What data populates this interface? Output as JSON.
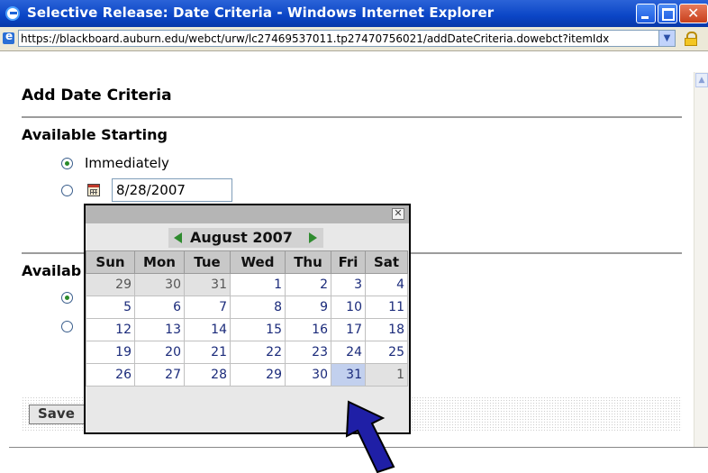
{
  "window": {
    "title": "Selective Release: Date Criteria - Windows Internet Explorer"
  },
  "address_bar": {
    "url": "https://blackboard.auburn.edu/webct/urw/lc27469537011.tp27470756021/addDateCriteria.dowebct?itemIdx",
    "icons": [
      "ie-page-icon",
      "dropdown-arrow-icon",
      "lock-icon"
    ]
  },
  "page": {
    "heading": "Add Date Criteria",
    "section_start": {
      "title": "Available Starting",
      "option_immediately": "Immediately",
      "date_value": "8/28/2007",
      "selected": "immediately"
    },
    "section_end": {
      "title_visible": "Availab"
    },
    "save_label": "Save"
  },
  "calendar": {
    "month_label": "August 2007",
    "close_glyph": "✕",
    "weekdays": [
      "Sun",
      "Mon",
      "Tue",
      "Wed",
      "Thu",
      "Fri",
      "Sat"
    ],
    "weeks": [
      [
        "29",
        "30",
        "31",
        "1",
        "2",
        "3",
        "4"
      ],
      [
        "5",
        "6",
        "7",
        "8",
        "9",
        "10",
        "11"
      ],
      [
        "12",
        "13",
        "14",
        "15",
        "16",
        "17",
        "18"
      ],
      [
        "19",
        "20",
        "21",
        "22",
        "23",
        "24",
        "25"
      ],
      [
        "26",
        "27",
        "28",
        "29",
        "30",
        "31",
        "1"
      ]
    ],
    "selected_day": "31",
    "colors": {
      "selected_bg": "#c2d0ee",
      "day_text": "#1a2a7a",
      "nav_arrow": "#2e8b2e"
    }
  },
  "annotation": {
    "arrow_color": "#1f1fa6"
  }
}
